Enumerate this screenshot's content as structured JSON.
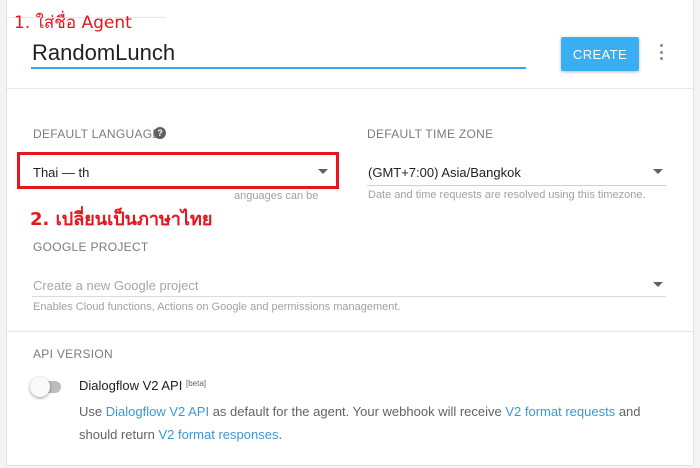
{
  "annotations": {
    "step1": "1. ใส่ชื่อ Agent",
    "step2": "2. เปลี่ยนเป็นภาษาไทย",
    "color": "#e8141e"
  },
  "agent": {
    "name": "RandomLunch",
    "create_label": "CREATE",
    "more_icon": "more-vert-icon"
  },
  "default_language": {
    "label": "DEFAULT LANGUAGE",
    "help_glyph": "?",
    "value": "Thai — th",
    "hint_partial": "anguages can be"
  },
  "default_time_zone": {
    "label": "DEFAULT TIME ZONE",
    "value": "(GMT+7:00) Asia/Bangkok",
    "hint": "Date and time requests are resolved using this timezone."
  },
  "google_project": {
    "label": "GOOGLE PROJECT",
    "placeholder": "Create a new Google project",
    "hint": "Enables Cloud functions, Actions on Google and permissions management."
  },
  "api_version": {
    "label": "API VERSION",
    "toggle_on": false,
    "title": "Dialogflow V2 API",
    "badge": "[beta]",
    "desc_1": "Use ",
    "desc_link_1": "Dialogflow V2 API",
    "desc_2": " as default for the agent. Your webhook will receive ",
    "desc_link_2": "V2 format requests",
    "desc_3": " and should return ",
    "desc_link_3": "V2 format responses",
    "desc_4": "."
  },
  "colors": {
    "accent": "#39aef1",
    "link": "#3a97d8",
    "underline": "#38a8ec"
  }
}
